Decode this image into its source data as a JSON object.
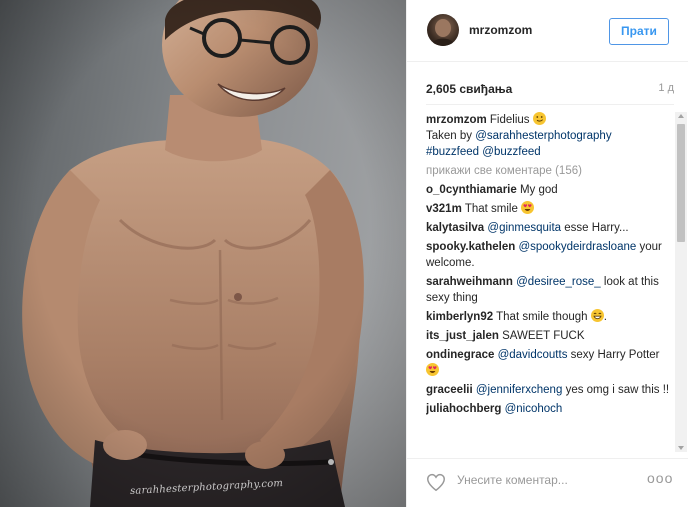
{
  "photo": {
    "alt_icon": "photo-image",
    "watermark": "sarahhesterphotography.com"
  },
  "header": {
    "username": "mrzomzom",
    "follow_label": "Прати",
    "avatar_icon": "avatar-photo"
  },
  "stats": {
    "likes": "2,605 свиђања",
    "time": "1 д"
  },
  "caption": {
    "username": "mrzomzom",
    "text": "Fidelius",
    "line2_prefix": "Taken by",
    "mention": "@sarahhesterphotography",
    "hashtag": "#buzzfeed",
    "mention2": "@buzzfeed"
  },
  "load_more": "прикажи све коментаре (156)",
  "comments": [
    {
      "user": "o_0cynthiamarie",
      "text": "My god"
    },
    {
      "user": "v321m",
      "text": "That smile"
    },
    {
      "user": "kalytasilva",
      "mention": "@ginmesquita",
      "text": "esse Harry..."
    },
    {
      "user": "spooky.kathelen",
      "mention": "@spookydeirdrasloane",
      "text": "your welcome."
    },
    {
      "user": "sarahweihmann",
      "mention": "@desiree_rose_",
      "text": "look at this sexy thing"
    },
    {
      "user": "kimberlyn92",
      "text": "That smile though",
      "suffix": "."
    },
    {
      "user": "its_just_jalen",
      "text": "SAWEET FUCK"
    },
    {
      "user": "ondinegrace",
      "mention": "@davidcoutts",
      "text": "sexy Harry Potter"
    },
    {
      "user": "graceelii",
      "mention": "@jenniferxcheng",
      "text": "yes omg i saw this !!"
    },
    {
      "user": "juliahochberg",
      "mention": "@nicohoch",
      "text": ""
    }
  ],
  "footer": {
    "comment_placeholder": "Унесите коментар...",
    "options_label": "ооо",
    "heart_icon": "heart-outline"
  },
  "colors": {
    "link": "#003569",
    "follow_blue": "#3897f0",
    "muted": "#999999",
    "border": "#efefef"
  }
}
